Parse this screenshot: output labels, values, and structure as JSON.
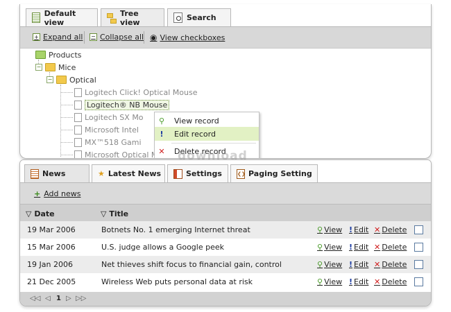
{
  "top_tabs": [
    {
      "label": "Default view",
      "icon": "list-icon"
    },
    {
      "label": "Tree view",
      "icon": "tree-icon"
    },
    {
      "label": "Search",
      "icon": "search-icon"
    }
  ],
  "toolbar": {
    "expand_all": "Expand all",
    "collapse_all": "Collapse all",
    "view_checkboxes": "View checkboxes"
  },
  "tree": {
    "products": "Products",
    "mice": "Mice",
    "optical": "Optical",
    "leaves": [
      "Logitech Click! Optical Mouse",
      "Logitech® NB Mouse",
      "Logitech SX Mo",
      "Microsoft Intel",
      "MX™518 Gami",
      "Microsoft Optical Mouse by Starck - Black"
    ]
  },
  "context_menu": {
    "view": "View record",
    "edit": "Edit record",
    "delete": "Delete record"
  },
  "watermark": "download",
  "bottom_tabs": [
    {
      "label": "News",
      "icon": "news-icon"
    },
    {
      "label": "Latest News",
      "icon": "star-icon"
    },
    {
      "label": "Settings",
      "icon": "settings-icon"
    },
    {
      "label": "Paging Setting",
      "icon": "paging-icon"
    }
  ],
  "add_news": "Add news",
  "columns": {
    "date": "Date",
    "title": "Title"
  },
  "actions": {
    "view": "View",
    "edit": "Edit",
    "delete": "Delete"
  },
  "news_rows": [
    {
      "date": "19 Mar 2006",
      "title": "Botnets No. 1 emerging Internet threat"
    },
    {
      "date": "15 Mar 2006",
      "title": "U.S. judge allows a Google peek"
    },
    {
      "date": "19 Jan 2006",
      "title": "Net thieves shift focus to financial gain, control"
    },
    {
      "date": "21 Dec 2005",
      "title": "Wireless Web puts personal data at risk"
    }
  ],
  "pager": {
    "current": "1"
  }
}
